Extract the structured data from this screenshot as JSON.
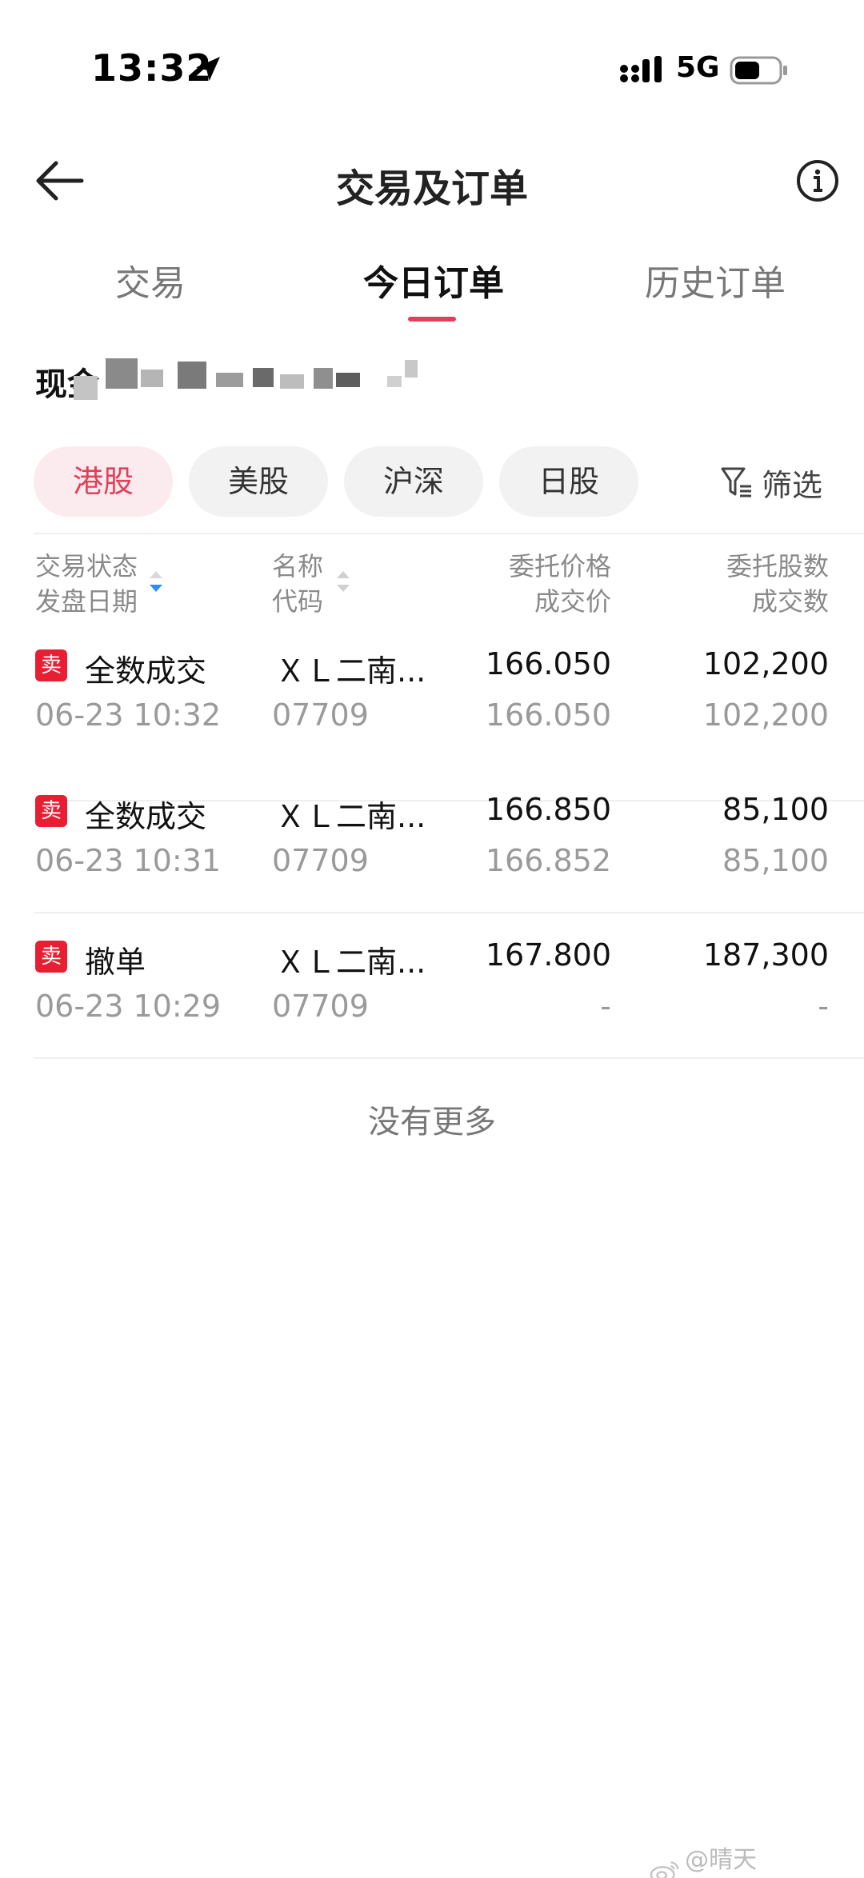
{
  "status_bar": {
    "time": "13:32",
    "network": "5G"
  },
  "header": {
    "title": "交易及订单"
  },
  "tabs": [
    {
      "label": "交易",
      "active": false
    },
    {
      "label": "今日订单",
      "active": true
    },
    {
      "label": "历史订单",
      "active": false
    }
  ],
  "account": {
    "label": "现金"
  },
  "markets": [
    {
      "label": "港股",
      "active": true
    },
    {
      "label": "美股",
      "active": false
    },
    {
      "label": "沪深",
      "active": false
    },
    {
      "label": "日股",
      "active": false
    }
  ],
  "filter": {
    "label": "筛选"
  },
  "columns": {
    "status": "交易状态",
    "date": "发盘日期",
    "name": "名称",
    "code": "代码",
    "price": "委托价格",
    "deal_price": "成交价",
    "qty": "委托股数",
    "deal_qty": "成交数"
  },
  "orders": [
    {
      "side": "卖",
      "status": "全数成交",
      "date": "06-23 10:32",
      "name": "ＸＬ二南...",
      "code": "07709",
      "price": "166.050",
      "deal_price": "166.050",
      "qty": "102,200",
      "deal_qty": "102,200"
    },
    {
      "side": "卖",
      "status": "全数成交",
      "date": "06-23 10:31",
      "name": "ＸＬ二南...",
      "code": "07709",
      "price": "166.850",
      "deal_price": "166.852",
      "qty": "85,100",
      "deal_qty": "85,100"
    },
    {
      "side": "卖",
      "status": "撤单",
      "date": "06-23 10:29",
      "name": "ＸＬ二南...",
      "code": "07709",
      "price": "167.800",
      "deal_price": "-",
      "qty": "187,300",
      "deal_qty": "-"
    }
  ],
  "footer": {
    "no_more": "没有更多"
  },
  "watermark": {
    "text": "@晴天WilliamLu"
  },
  "colors": {
    "accent": "#e1405a",
    "sell_badge": "#e81e33",
    "sort_active": "#2f8ce8",
    "chip_bg": "#f2f2f2"
  }
}
